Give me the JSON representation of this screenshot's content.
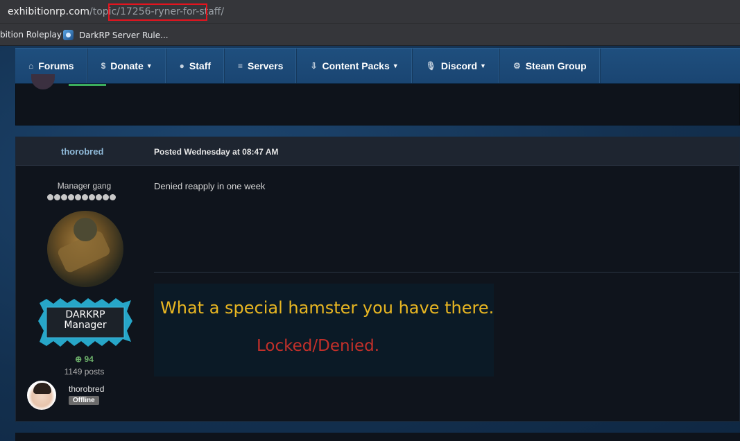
{
  "browser": {
    "url_host": "exhibitionrp.com",
    "url_path": "/topic/",
    "url_slug": "17256-ryner-for-staff/",
    "bookmarks": [
      {
        "label": "bition Roleplay"
      },
      {
        "label": "DarkRP Server Rule..."
      }
    ]
  },
  "nav": {
    "items": [
      {
        "label": "Forums",
        "icon": "home-icon",
        "glyph": "⌂",
        "caret": ""
      },
      {
        "label": "Donate",
        "icon": "dollar-icon",
        "glyph": "$",
        "caret": "▼"
      },
      {
        "label": "Staff",
        "icon": "user-icon",
        "glyph": "●",
        "caret": ""
      },
      {
        "label": "Servers",
        "icon": "server-icon",
        "glyph": "≡",
        "caret": ""
      },
      {
        "label": "Content Packs",
        "icon": "download-icon",
        "glyph": "⇩",
        "caret": "▼"
      },
      {
        "label": "Discord",
        "icon": "microphone-icon",
        "glyph": "🎙",
        "caret": "▼"
      },
      {
        "label": "Steam Group",
        "icon": "steam-icon",
        "glyph": "⚙",
        "caret": ""
      }
    ]
  },
  "post": {
    "author": "thorobred",
    "date_text": "Posted Wednesday at 08:47 AM",
    "group_title": "Manager gang",
    "pip_count": 10,
    "rank_line1": "DARKRP",
    "rank_line2": "Manager",
    "reputation": "94",
    "post_count": "1149 posts",
    "body": "Denied reapply in one week",
    "signature_line1": "What a special hamster you have there.",
    "signature_line2": "Locked/Denied.",
    "mini_name": "thorobred",
    "status": "Offline"
  },
  "colors": {
    "accent_blue": "#1f4f7e",
    "signature_yellow": "#e8b622",
    "signature_red": "#c2302a",
    "url_highlight": "#e3141e",
    "reputation_green": "#6cb06a"
  }
}
